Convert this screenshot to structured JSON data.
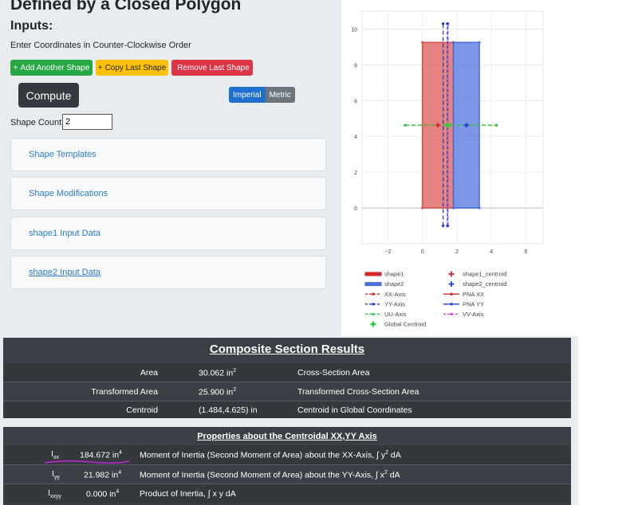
{
  "page": {
    "title": "Defined by a Closed Polygon",
    "inputs_heading": "Inputs:",
    "instructions": "Enter Coordinates in Counter-Clockwise Order"
  },
  "toolbar": {
    "add_shape": "Add Another Shape",
    "copy_shape": "Copy Last Shape",
    "remove_shape": "Remove Last Shape",
    "compute": "Compute",
    "add_icon": "+",
    "copy_icon": "+",
    "trash_icon": "trash-icon"
  },
  "units": {
    "imperial": "Imperial",
    "metric": "Metric",
    "selected": "Imperial"
  },
  "shape_count": {
    "label": "Shape Count:",
    "value": "2"
  },
  "accordion": [
    {
      "label": "Shape Templates"
    },
    {
      "label": "Shape Modifications"
    },
    {
      "label": "shape1 Input Data"
    },
    {
      "label": "shape2 Input Data"
    }
  ],
  "chart_data": {
    "type": "scatter",
    "xlim": [
      -3.5,
      7
    ],
    "ylim": [
      -2,
      11
    ],
    "x_ticks": [
      -2,
      0,
      2,
      4,
      6
    ],
    "y_ticks": [
      0,
      2,
      4,
      6,
      8,
      10
    ],
    "grid": true,
    "legend_position": "bottom",
    "shapes": [
      {
        "name": "shape1",
        "color": "#d9534f",
        "points": [
          [
            0,
            0
          ],
          [
            1.8,
            0
          ],
          [
            1.8,
            9.25
          ],
          [
            0,
            9.25
          ]
        ]
      },
      {
        "name": "shape2",
        "color": "#4a6fdc",
        "points": [
          [
            1.8,
            0
          ],
          [
            3.3,
            0
          ],
          [
            3.3,
            9.25
          ],
          [
            1.8,
            9.25
          ]
        ]
      }
    ],
    "centroids": [
      {
        "name": "shape1_centroid",
        "x": 0.9,
        "y": 4.625,
        "color": "#d62728"
      },
      {
        "name": "shape2_centroid",
        "x": 2.55,
        "y": 4.625,
        "color": "#1f3fd1"
      },
      {
        "name": "Global Centroid",
        "x": 1.484,
        "y": 4.625,
        "color": "#2ecc40"
      }
    ],
    "axes_lines": [
      {
        "name": "XX-Axis",
        "color": "#d62728",
        "x": [
          -1,
          4.3
        ],
        "y": [
          4.625,
          4.625
        ]
      },
      {
        "name": "YY-Axis",
        "color": "#1f3fd1",
        "x": [
          1.2,
          1.2
        ],
        "y": [
          -1,
          10.3
        ]
      },
      {
        "name": "UU-Axis",
        "color": "#2ecc40",
        "x": [
          -1,
          4.3
        ],
        "y": [
          4.625,
          4.625
        ]
      },
      {
        "name": "VV-Axis",
        "color": "#e044e0",
        "x": [
          1.484,
          1.484
        ],
        "y": [
          -1,
          10.3
        ]
      },
      {
        "name": "PNA YY",
        "color": "#1f3fd1",
        "x": [
          1.45,
          1.45
        ],
        "y": [
          -1,
          10.3
        ]
      }
    ],
    "legend": [
      {
        "name": "shape1",
        "color": "#d62728",
        "kind": "fill"
      },
      {
        "name": "shape1_centroid",
        "color": "#d62728",
        "kind": "cross"
      },
      {
        "name": "shape2",
        "color": "#4a6fdc",
        "kind": "fill"
      },
      {
        "name": "shape2_centroid",
        "color": "#1f3fd1",
        "kind": "cross"
      },
      {
        "name": "XX-Axis",
        "color": "#d62728",
        "kind": "dash"
      },
      {
        "name": "PNA XX",
        "color": "#d62728",
        "kind": "line"
      },
      {
        "name": "YY-Axis",
        "color": "#1f3fd1",
        "kind": "dash"
      },
      {
        "name": "PNA YY",
        "color": "#1f3fd1",
        "kind": "line"
      },
      {
        "name": "UU-Axis",
        "color": "#2ecc40",
        "kind": "dash"
      },
      {
        "name": "VV-Axis",
        "color": "#e044e0",
        "kind": "dash"
      },
      {
        "name": "Global Centroid",
        "color": "#2ecc40",
        "kind": "cross"
      }
    ]
  },
  "composite": {
    "title": "Composite Section Results",
    "rows": [
      {
        "label": "Area",
        "value": "30.062 in",
        "sup": "2",
        "unit_after": "",
        "desc": "Cross-Section Area"
      },
      {
        "label": "Transformed Area",
        "value": "25.900 in",
        "sup": "2",
        "unit_after": "",
        "desc": "Transformed Cross-Section Area"
      },
      {
        "label": "Centroid",
        "value": "(1.484,4.625) in",
        "sup": "",
        "unit_after": "",
        "desc": "Centroid in Global Coordinates"
      }
    ]
  },
  "centroidal": {
    "title": "Properties about the Centroidal XX,YY Axis",
    "rows": [
      {
        "symbol": "I",
        "sub": "xx",
        "value": "184.672 in",
        "sup": "4",
        "desc": "Moment of Inertia (Second Moment of Area) about the XX-Axis, ∫ y",
        "desc_sup": "2",
        "desc_end": " dA"
      },
      {
        "symbol": "I",
        "sub": "yy",
        "value": "21.982 in",
        "sup": "4",
        "desc": "Moment of Inertia (Second Moment of Area) about the YY-Axis, ∫ x",
        "desc_sup": "2",
        "desc_end": " dA"
      },
      {
        "symbol": "I",
        "sub": "xxyy",
        "value": "0.000 in",
        "sup": "4",
        "desc": "Product of Inertia, ∫ x y dA",
        "desc_sup": "",
        "desc_end": ""
      }
    ],
    "highlight_color": "#c026d3"
  }
}
